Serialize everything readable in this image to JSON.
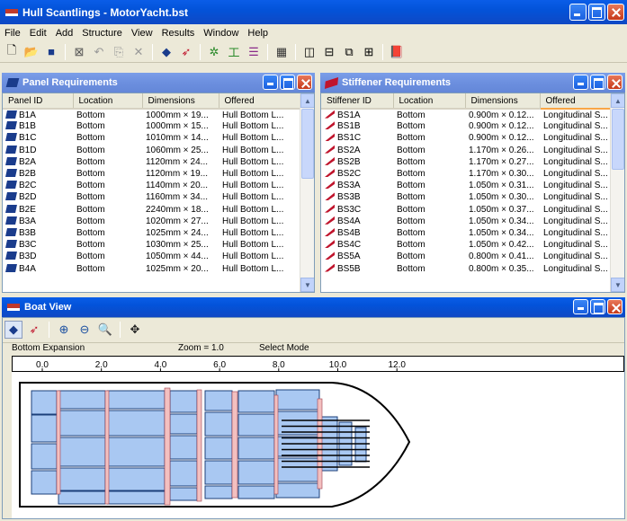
{
  "window": {
    "title": "Hull Scantlings - MotorYacht.bst"
  },
  "menu": [
    "File",
    "Edit",
    "Add",
    "Structure",
    "View",
    "Results",
    "Window",
    "Help"
  ],
  "toolbar": {
    "buttons": [
      "new-icon",
      "open-icon",
      "save-icon",
      "fit-icon",
      "undo-icon",
      "copy-icon",
      "delete-icon",
      "panel-icon",
      "stiffener-icon",
      "frame-icon",
      "girder-icon",
      "layers-icon",
      "calculator-icon",
      "view1-icon",
      "view2-icon",
      "view3-icon",
      "view4-icon",
      "book-icon"
    ]
  },
  "panel_requirements": {
    "title": "Panel Requirements",
    "columns": [
      "Panel ID",
      "Location",
      "Dimensions",
      "Offered"
    ],
    "rows": [
      [
        "B1A",
        "Bottom",
        "1000mm × 19...",
        "Hull Bottom L..."
      ],
      [
        "B1B",
        "Bottom",
        "1000mm × 15...",
        "Hull Bottom L..."
      ],
      [
        "B1C",
        "Bottom",
        "1010mm × 14...",
        "Hull Bottom L..."
      ],
      [
        "B1D",
        "Bottom",
        "1060mm × 25...",
        "Hull Bottom L..."
      ],
      [
        "B2A",
        "Bottom",
        "1120mm × 24...",
        "Hull Bottom L..."
      ],
      [
        "B2B",
        "Bottom",
        "1120mm × 19...",
        "Hull Bottom L..."
      ],
      [
        "B2C",
        "Bottom",
        "1140mm × 20...",
        "Hull Bottom L..."
      ],
      [
        "B2D",
        "Bottom",
        "1160mm × 34...",
        "Hull Bottom L..."
      ],
      [
        "B2E",
        "Bottom",
        "2240mm × 18...",
        "Hull Bottom L..."
      ],
      [
        "B3A",
        "Bottom",
        "1020mm × 27...",
        "Hull Bottom L..."
      ],
      [
        "B3B",
        "Bottom",
        "1025mm × 24...",
        "Hull Bottom L..."
      ],
      [
        "B3C",
        "Bottom",
        "1030mm × 25...",
        "Hull Bottom L..."
      ],
      [
        "B3D",
        "Bottom",
        "1050mm × 44...",
        "Hull Bottom L..."
      ],
      [
        "B4A",
        "Bottom",
        "1025mm × 20...",
        "Hull Bottom L..."
      ]
    ]
  },
  "stiffener_requirements": {
    "title": "Stiffener Requirements",
    "columns": [
      "Stiffener ID",
      "Location",
      "Dimensions",
      "Offered"
    ],
    "rows": [
      [
        "BS1A",
        "Bottom",
        "0.900m × 0.12...",
        "Longitudinal S..."
      ],
      [
        "BS1B",
        "Bottom",
        "0.900m × 0.12...",
        "Longitudinal S..."
      ],
      [
        "BS1C",
        "Bottom",
        "0.900m × 0.12...",
        "Longitudinal S..."
      ],
      [
        "BS2A",
        "Bottom",
        "1.170m × 0.26...",
        "Longitudinal S..."
      ],
      [
        "BS2B",
        "Bottom",
        "1.170m × 0.27...",
        "Longitudinal S..."
      ],
      [
        "BS2C",
        "Bottom",
        "1.170m × 0.30...",
        "Longitudinal S..."
      ],
      [
        "BS3A",
        "Bottom",
        "1.050m × 0.31...",
        "Longitudinal S..."
      ],
      [
        "BS3B",
        "Bottom",
        "1.050m × 0.30...",
        "Longitudinal S..."
      ],
      [
        "BS3C",
        "Bottom",
        "1.050m × 0.37...",
        "Longitudinal S..."
      ],
      [
        "BS4A",
        "Bottom",
        "1.050m × 0.34...",
        "Longitudinal S..."
      ],
      [
        "BS4B",
        "Bottom",
        "1.050m × 0.34...",
        "Longitudinal S..."
      ],
      [
        "BS4C",
        "Bottom",
        "1.050m × 0.42...",
        "Longitudinal S..."
      ],
      [
        "BS5A",
        "Bottom",
        "0.800m × 0.41...",
        "Longitudinal S..."
      ],
      [
        "BS5B",
        "Bottom",
        "0.800m × 0.35...",
        "Longitudinal S..."
      ]
    ]
  },
  "boat_view": {
    "title": "Boat View",
    "status": {
      "view": "Bottom Expansion",
      "zoom": "Zoom = 1.0",
      "mode": "Select Mode"
    },
    "ruler": [
      "0.0",
      "2.0",
      "4.0",
      "6.0",
      "8.0",
      "10.0",
      "12.0"
    ]
  },
  "colors": {
    "titlebar": "#0353d9",
    "panel_fill": "#a9c8f2",
    "stiffener_fill": "#f3c0c0",
    "hull_line": "#000000"
  }
}
